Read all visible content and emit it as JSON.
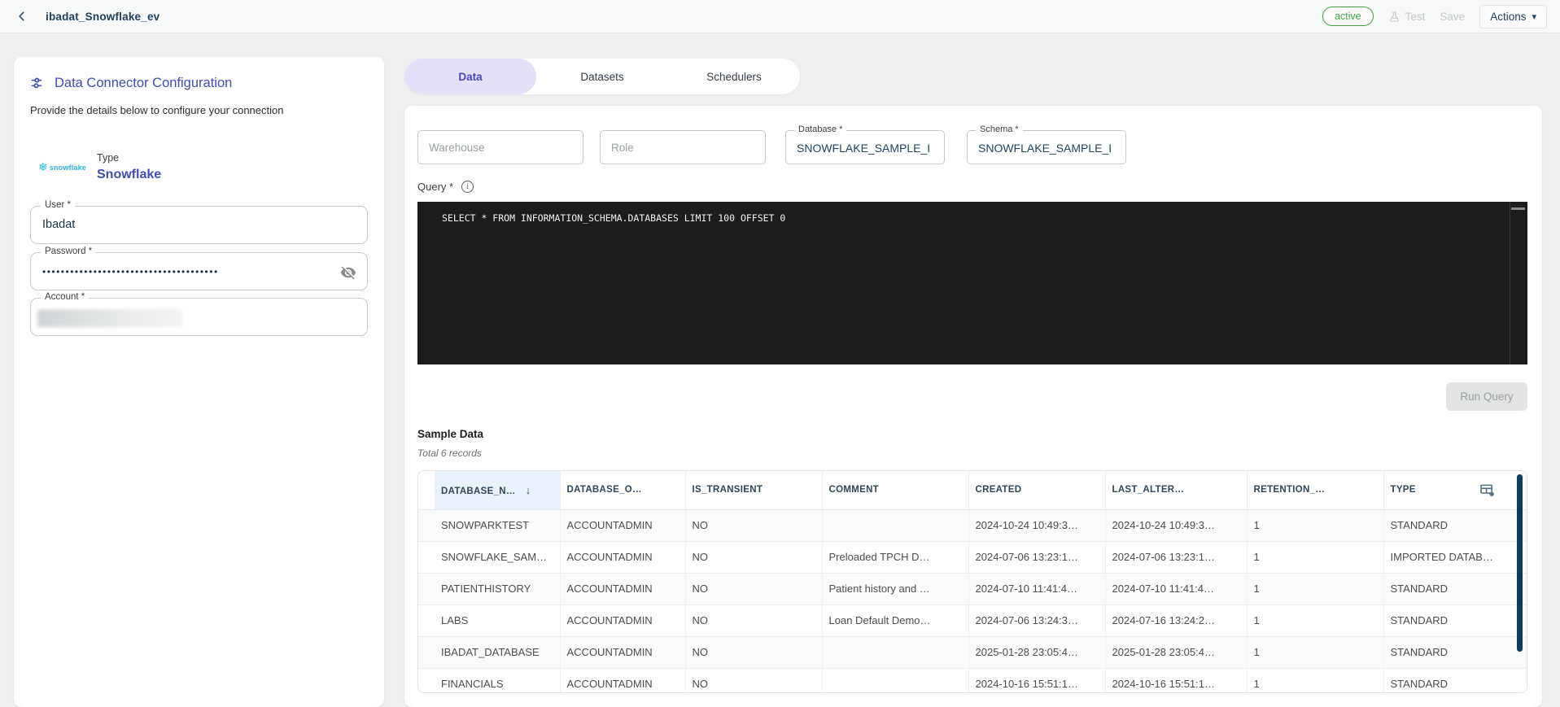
{
  "header": {
    "title": "ibadat_Snowflake_ev",
    "status_badge": "active",
    "test_label": "Test",
    "save_label": "Save",
    "actions_label": "Actions"
  },
  "sidebar": {
    "title": "Data Connector Configuration",
    "subtitle": "Provide the details below to configure your connection",
    "type_label": "Type",
    "type_value": "Snowflake",
    "logo_word": "snowflake",
    "fields": {
      "user": {
        "label": "User *",
        "value": "Ibadat"
      },
      "password": {
        "label": "Password *",
        "value": "••••••••••••••••••••••••••••••••••••••"
      },
      "account": {
        "label": "Account *"
      }
    }
  },
  "tabs": [
    {
      "label": "Data",
      "active": true
    },
    {
      "label": "Datasets",
      "active": false
    },
    {
      "label": "Schedulers",
      "active": false
    }
  ],
  "form": {
    "warehouse_placeholder": "Warehouse",
    "role_placeholder": "Role",
    "database": {
      "label": "Database *",
      "value": "SNOWFLAKE_SAMPLE_I"
    },
    "schema": {
      "label": "Schema *",
      "value": "SNOWFLAKE_SAMPLE_I"
    },
    "query_label": "Query *",
    "query_text": "SELECT * FROM INFORMATION_SCHEMA.DATABASES LIMIT 100 OFFSET 0",
    "run_query_label": "Run Query"
  },
  "sample_data": {
    "title": "Sample Data",
    "subtitle": "Total 6 records",
    "sorted_column_index": 0,
    "columns": [
      "DATABASE_N…",
      "DATABASE_O…",
      "IS_TRANSIENT",
      "COMMENT",
      "CREATED",
      "LAST_ALTER…",
      "RETENTION_…",
      "TYPE"
    ],
    "rows": [
      [
        "SNOWPARKTEST",
        "ACCOUNTADMIN",
        "NO",
        "",
        "2024-10-24 10:49:3…",
        "2024-10-24 10:49:3…",
        "1",
        "STANDARD"
      ],
      [
        "SNOWFLAKE_SAM…",
        "ACCOUNTADMIN",
        "NO",
        "Preloaded TPCH D…",
        "2024-07-06 13:23:1…",
        "2024-07-06 13:23:1…",
        "1",
        "IMPORTED DATAB…"
      ],
      [
        "PATIENTHISTORY",
        "ACCOUNTADMIN",
        "NO",
        "Patient history and …",
        "2024-07-10 11:41:4…",
        "2024-07-10 11:41:4…",
        "1",
        "STANDARD"
      ],
      [
        "LABS",
        "ACCOUNTADMIN",
        "NO",
        "Loan Default Demo…",
        "2024-07-06 13:24:3…",
        "2024-07-16 13:24:2…",
        "1",
        "STANDARD"
      ],
      [
        "IBADAT_DATABASE",
        "ACCOUNTADMIN",
        "NO",
        "",
        "2025-01-28 23:05:4…",
        "2025-01-28 23:05:4…",
        "1",
        "STANDARD"
      ],
      [
        "FINANCIALS",
        "ACCOUNTADMIN",
        "NO",
        "",
        "2024-10-16 15:51:1…",
        "2024-10-16 15:51:1…",
        "1",
        "STANDARD"
      ]
    ]
  },
  "colors": {
    "accent_indigo": "#3f4cb5",
    "active_tab_bg": "#e3e0f8",
    "status_green": "#3fa142",
    "snowflake_blue": "#29b5e8",
    "editor_bg": "#1c1c1e",
    "sorted_header_bg": "#e9f2fa",
    "scrollbar_navy": "#0e3c5e",
    "dark_navy_text": "#20415e"
  }
}
